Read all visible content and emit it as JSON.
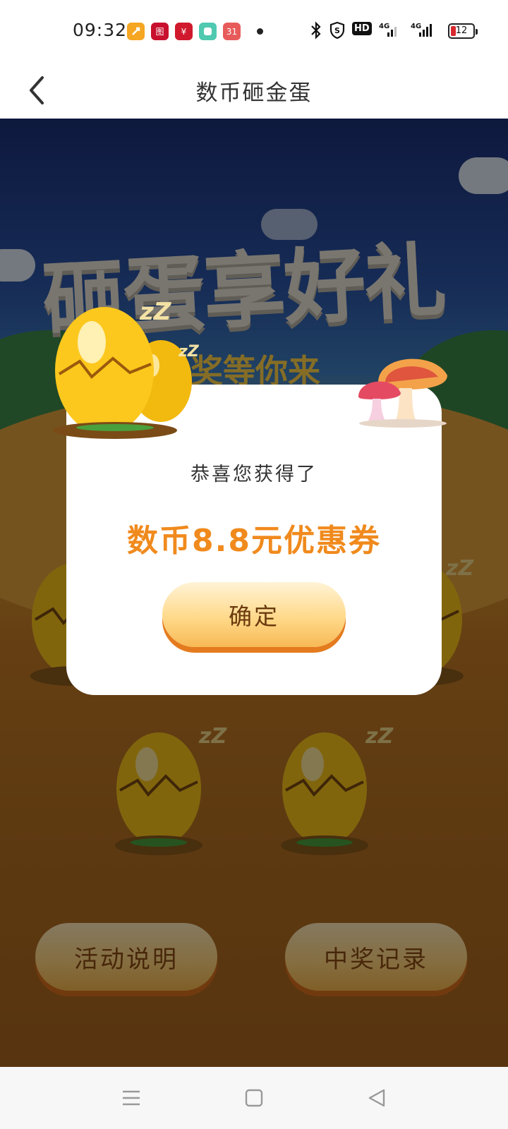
{
  "status_bar": {
    "time": "09:32",
    "notifications": [
      {
        "icon": "app-notification-icon",
        "color": "#f5a623",
        "text": ""
      },
      {
        "icon": "bank-app-icon",
        "color": "#c8102e",
        "text": "图"
      },
      {
        "icon": "bank-app-icon",
        "color": "#d0192d",
        "text": "¥"
      },
      {
        "icon": "app-notification-icon",
        "color": "#4fc9b0",
        "text": ""
      },
      {
        "icon": "calendar-icon",
        "color": "#e85b5b",
        "text": "31"
      }
    ],
    "network": "4G",
    "network_secondary": "4G",
    "hd_label": "HD",
    "battery": "12"
  },
  "header": {
    "title": "数币砸金蛋"
  },
  "game": {
    "banner_title": "砸蛋享好礼",
    "banner_subtitle": "奖等你来",
    "activity_button": "活动说明",
    "records_button": "中奖记录",
    "colors": {
      "egg": "#f7c21a",
      "accent": "#f08a1d"
    }
  },
  "dialog": {
    "label": "恭喜您获得了",
    "prize": "数币8.8元优惠券",
    "confirm_button": "确定"
  },
  "navbar": {
    "items": [
      "menu-icon",
      "home-icon",
      "back-triangle-icon"
    ]
  }
}
